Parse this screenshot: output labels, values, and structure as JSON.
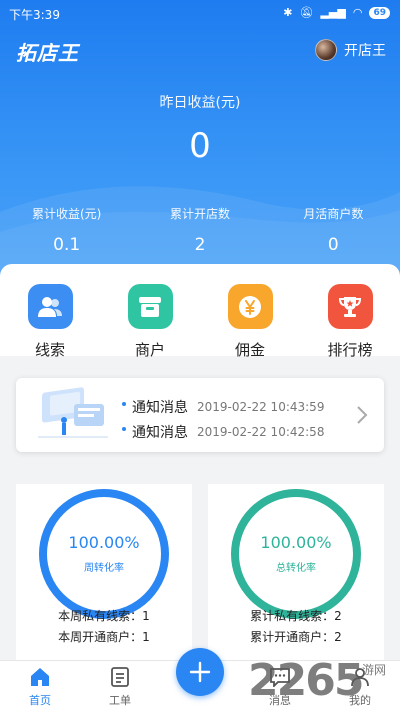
{
  "status": {
    "time": "下午3:39",
    "battery": "69"
  },
  "header": {
    "app_title": "拓店王",
    "store_name": "开店王"
  },
  "yesterday": {
    "label": "昨日收益(元)",
    "value": "0"
  },
  "stats": [
    {
      "label": "累计收益(元)",
      "value": "0.1"
    },
    {
      "label": "累计开店数",
      "value": "2"
    },
    {
      "label": "月活商户数",
      "value": "0"
    }
  ],
  "shortcuts": [
    {
      "label": "线索",
      "icon": "users-icon",
      "color": "#3d8ef3"
    },
    {
      "label": "商户",
      "icon": "store-icon",
      "color": "#2fc5a3"
    },
    {
      "label": "佣金",
      "icon": "yen-icon",
      "color": "#f8a72c"
    },
    {
      "label": "排行榜",
      "icon": "trophy-icon",
      "color": "#f2553d"
    }
  ],
  "notices": [
    {
      "title": "通知消息",
      "time": "2019-02-22 10:43:59"
    },
    {
      "title": "通知消息",
      "time": "2019-02-22 10:42:58"
    }
  ],
  "weekly": {
    "percent": "100.00%",
    "caption": "周转化率",
    "line1": "本周私有线索：1",
    "line2": "本周开通商户：1",
    "color": "#2a86f2"
  },
  "total": {
    "percent": "100.00%",
    "caption": "总转化率",
    "line1": "累计私有线索：2",
    "line2": "累计开通商户：2",
    "color": "#2fb39a"
  },
  "tabs": [
    {
      "label": "首页",
      "icon": "home-icon"
    },
    {
      "label": "工单",
      "icon": "workorder-icon"
    },
    {
      "label": "消息",
      "icon": "message-icon"
    },
    {
      "label": "我的",
      "icon": "profile-icon"
    }
  ],
  "watermark": {
    "number": "2265",
    "text": "游网"
  },
  "colors": {
    "accent": "#2a86f2"
  }
}
